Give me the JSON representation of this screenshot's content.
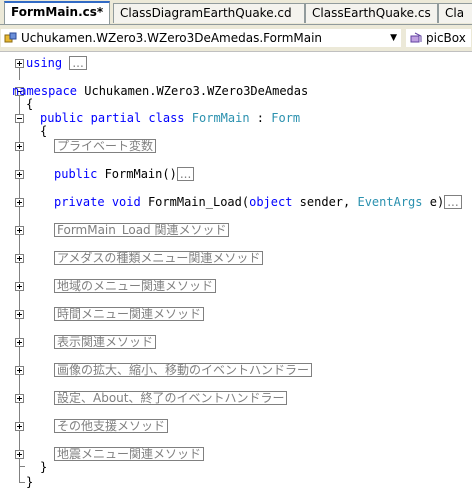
{
  "tabs": [
    {
      "label": "FormMain.cs*",
      "active": true
    },
    {
      "label": "ClassDiagramEarthQuake.cd",
      "active": false
    },
    {
      "label": "ClassEarthQuake.cs",
      "active": false
    },
    {
      "label": "Cla",
      "active": false
    }
  ],
  "navbar": {
    "type_combo": "Uchukamen.WZero3.WZero3DeAmedas.FormMain",
    "member_combo": "picBox"
  },
  "code": {
    "using_kw": "using",
    "using_fold": "...",
    "namespace_kw": "namespace",
    "namespace_name": " Uchukamen.WZero3.WZero3DeAmedas",
    "open_brace_ns": "{",
    "class_public": "public",
    "class_partial": "partial",
    "class_kw": "class",
    "class_name": "FormMain",
    "class_colon": " : ",
    "class_base": "Form",
    "open_brace_class": "{",
    "region_private_vars": "プライベート変数",
    "ctor_public": "public",
    "ctor_name": " FormMain()",
    "ctor_fold": "...",
    "load_private": "private",
    "load_void": "void",
    "load_name": " FormMain_Load(",
    "load_object": "object",
    "load_sender": " sender, ",
    "load_eventargs": "EventArgs",
    "load_e": " e)",
    "load_fold": "...",
    "regions": [
      "FormMain_Load 関連メソッド",
      "アメダスの種類メニュー関連メソッド",
      "地域のメニュー関連メソッド",
      "時間メニュー関連メソッド",
      "表示関連メソッド",
      "画像の拡大、縮小、移動のイベントハンドラー",
      "設定、About、終了のイベントハンドラー",
      "その他支援メソッド",
      "地震メニュー関連メソッド"
    ],
    "close_brace_class": "}",
    "close_brace_ns": "}"
  }
}
